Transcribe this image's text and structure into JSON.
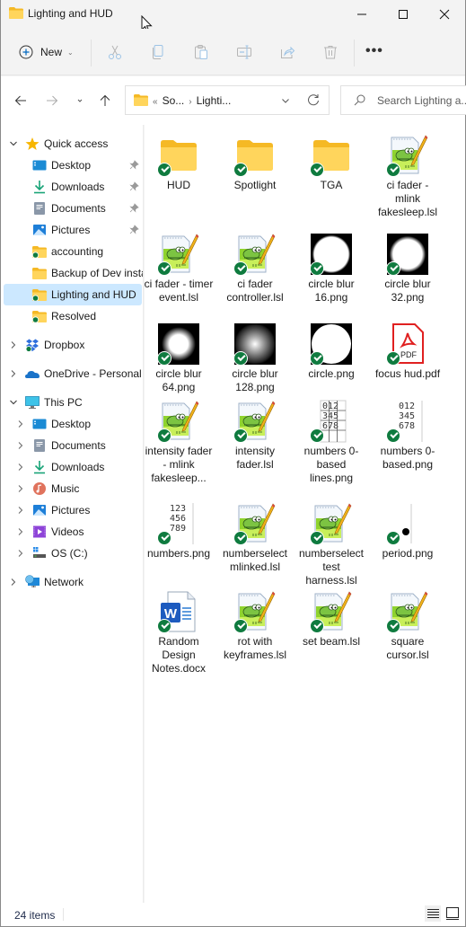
{
  "window": {
    "title": "Lighting and HUD"
  },
  "commandbar": {
    "new_label": "New",
    "actions": [
      "cut",
      "copy",
      "paste",
      "rename",
      "share",
      "delete",
      "more"
    ]
  },
  "navigation": {
    "breadcrumb": [
      "So...",
      "Lighti..."
    ],
    "overflow_glyph": "«",
    "search_placeholder": "Search Lighting a..."
  },
  "sidebar": {
    "quick_access": {
      "label": "Quick access",
      "items": [
        {
          "label": "Desktop",
          "icon": "desktop-icon",
          "pinned": true
        },
        {
          "label": "Downloads",
          "icon": "downloads-icon",
          "pinned": true
        },
        {
          "label": "Documents",
          "icon": "documents-icon",
          "pinned": true
        },
        {
          "label": "Pictures",
          "icon": "pictures-icon",
          "pinned": true
        },
        {
          "label": "accounting",
          "icon": "folder-synced-icon",
          "pinned": false
        },
        {
          "label": "Backup of Dev insta",
          "icon": "folder-icon",
          "pinned": false
        },
        {
          "label": "Lighting and HUD",
          "icon": "folder-synced-icon",
          "pinned": false,
          "selected": true
        },
        {
          "label": "Resolved",
          "icon": "folder-synced-icon",
          "pinned": false
        }
      ]
    },
    "dropbox": {
      "label": "Dropbox"
    },
    "onedrive": {
      "label": "OneDrive - Personal"
    },
    "this_pc": {
      "label": "This PC",
      "items": [
        {
          "label": "Desktop"
        },
        {
          "label": "Documents"
        },
        {
          "label": "Downloads"
        },
        {
          "label": "Music"
        },
        {
          "label": "Pictures"
        },
        {
          "label": "Videos"
        },
        {
          "label": "OS (C:)"
        }
      ]
    },
    "network": {
      "label": "Network"
    }
  },
  "files": [
    {
      "name": "HUD",
      "type": "folder"
    },
    {
      "name": "Spotlight",
      "type": "folder"
    },
    {
      "name": "TGA",
      "type": "folder"
    },
    {
      "name": "ci fader - mlink fakesleep.lsl",
      "type": "lsl"
    },
    {
      "name": "ci fader - timer event.lsl",
      "type": "lsl"
    },
    {
      "name": "ci fader controller.lsl",
      "type": "lsl"
    },
    {
      "name": "circle blur 16.png",
      "type": "blur16"
    },
    {
      "name": "circle blur 32.png",
      "type": "blur32"
    },
    {
      "name": "circle blur 64.png",
      "type": "blur64"
    },
    {
      "name": "circle blur 128.png",
      "type": "blur128"
    },
    {
      "name": "circle.png",
      "type": "circle"
    },
    {
      "name": "focus hud.pdf",
      "type": "pdf"
    },
    {
      "name": "intensity fader - mlink fakesleep...",
      "type": "lsl"
    },
    {
      "name": "intensity fader.lsl",
      "type": "lsl"
    },
    {
      "name": "numbers 0-based lines.png",
      "type": "numlines"
    },
    {
      "name": "numbers 0-based.png",
      "type": "num0"
    },
    {
      "name": "numbers.png",
      "type": "num1"
    },
    {
      "name": "numberselect mlinked.lsl",
      "type": "lsl"
    },
    {
      "name": "numberselect test harness.lsl",
      "type": "lsl"
    },
    {
      "name": "period.png",
      "type": "period"
    },
    {
      "name": "Random Design Notes.docx",
      "type": "docx"
    },
    {
      "name": "rot with keyframes.lsl",
      "type": "lsl"
    },
    {
      "name": "set beam.lsl",
      "type": "lsl"
    },
    {
      "name": "square cursor.lsl",
      "type": "lsl"
    }
  ],
  "status": {
    "item_count": "24 items"
  },
  "colors": {
    "accent": "#0067c0",
    "selection": "#cce8ff",
    "sync_check": "#0f7b3f",
    "folder": "#ffc83d"
  }
}
